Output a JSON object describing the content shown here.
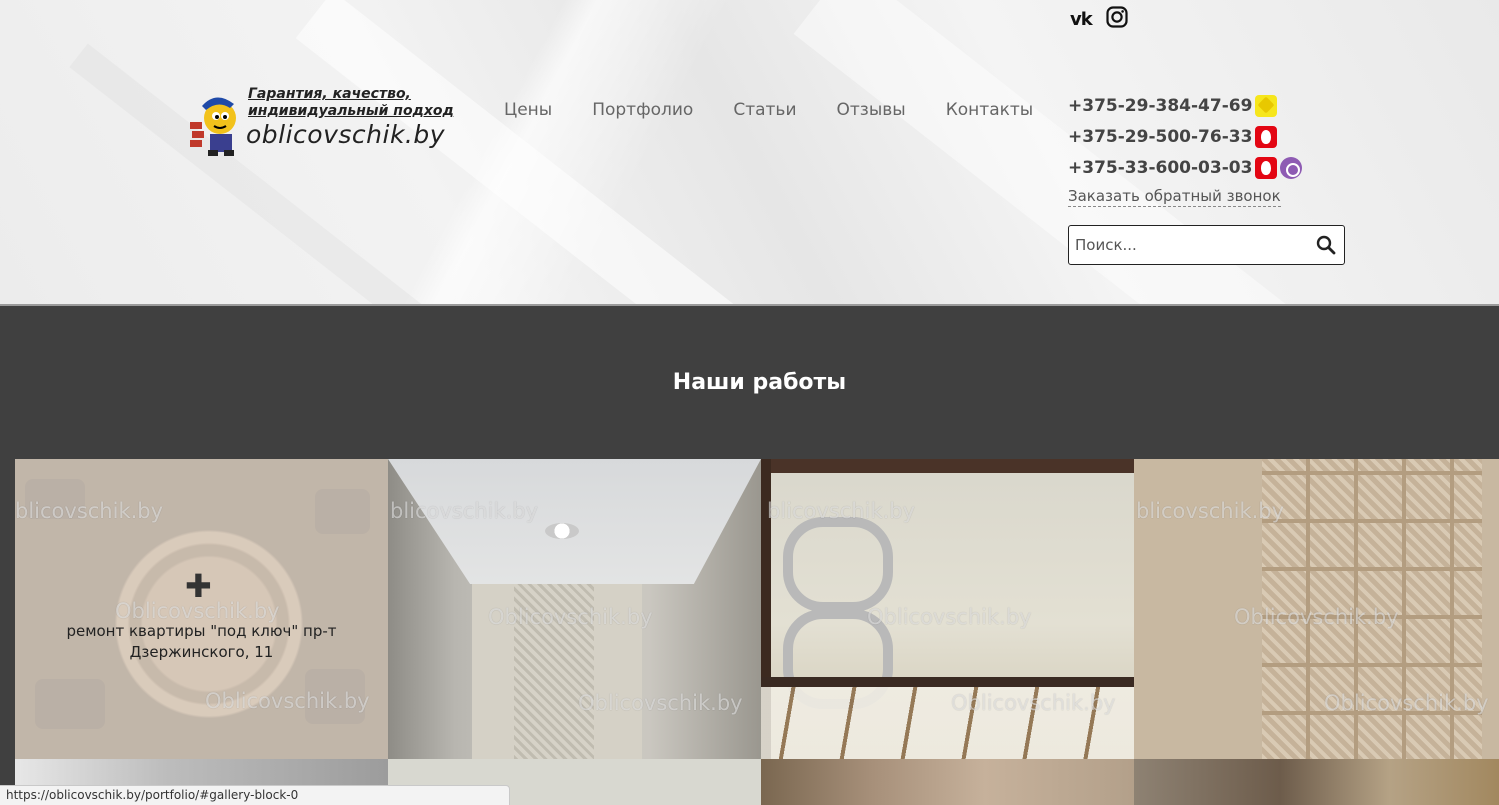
{
  "header": {
    "logo": {
      "tagline_line1": "Гарантия, качество,",
      "tagline_line2": "индивидуальный подход",
      "site": "oblicovschik.by"
    },
    "nav": [
      {
        "label": "Цены"
      },
      {
        "label": "Портфолио"
      },
      {
        "label": "Статьи"
      },
      {
        "label": "Отзывы"
      },
      {
        "label": "Контакты"
      }
    ],
    "social": {
      "vk_label": "vk",
      "icons": [
        "vk-icon",
        "instagram-icon"
      ]
    },
    "phones": [
      {
        "number": "+375-29-384-47-69",
        "operators": [
          "life"
        ]
      },
      {
        "number": "+375-29-500-76-33",
        "operators": [
          "mts"
        ]
      },
      {
        "number": "+375-33-600-03-03",
        "operators": [
          "mts",
          "viber"
        ]
      }
    ],
    "callback_label": "Заказать обратный звонок",
    "search": {
      "placeholder": "Поиск..."
    }
  },
  "section": {
    "title": "Наши работы"
  },
  "gallery": {
    "watermark_text": "Oblicovschik.by",
    "watermark_text_cut": "blicovschik.by",
    "items": [
      {
        "caption": "ремонт квартиры \"под ключ\" пр-т Дзержинского, 11",
        "hovered": true
      },
      {
        "caption": ""
      },
      {
        "caption": ""
      },
      {
        "caption": ""
      }
    ]
  },
  "statusbar": {
    "url": "https://oblicovschik.by/portfolio/#gallery-block-0"
  },
  "colors": {
    "section_bg": "#404040",
    "life": "#f6e61c",
    "mts": "#e30613",
    "viber": "#8e5bb3"
  }
}
